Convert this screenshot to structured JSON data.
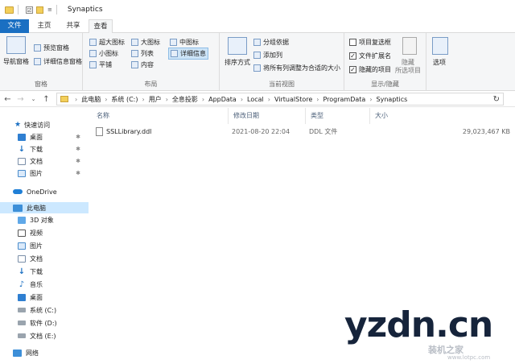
{
  "titlebar": {
    "title": "Synaptics",
    "qa_check": "☑",
    "qa_caret": "≡"
  },
  "tabs": {
    "file": "文件",
    "home": "主页",
    "share": "共享",
    "view": "查看"
  },
  "ribbon": {
    "panes": {
      "nav_pane": "导航窗格",
      "preview_pane": "预览窗格",
      "details_pane": "详细信息窗格",
      "label": "窗格"
    },
    "layout": {
      "xl_icons": "超大图标",
      "large_icons": "大图标",
      "medium_icons": "中图标",
      "small_icons": "小图标",
      "list": "列表",
      "details": "详细信息",
      "tiles": "平铺",
      "content": "内容",
      "label": "布局"
    },
    "current_view": {
      "sort_by": "排序方式",
      "group_by": "分组依据",
      "add_columns": "添加列",
      "size_all_columns": "将所有列调整为合适的大小",
      "label": "当前视图"
    },
    "show_hide": {
      "item_checkboxes": "项目复选框",
      "file_extensions": "文件扩展名",
      "hidden_items": "隐藏的项目",
      "hide_selected": "隐藏",
      "hide_selected_sub": "所选项目",
      "label": "显示/隐藏",
      "item_checkboxes_checked": false,
      "file_extensions_checked": true,
      "hidden_items_checked": true
    },
    "options": "选项"
  },
  "address": {
    "crumbs": [
      "此电脑",
      "系统 (C:)",
      "用户",
      "全息投影",
      "AppData",
      "Local",
      "VirtualStore",
      "ProgramData",
      "Synaptics"
    ]
  },
  "sidebar": {
    "quick_access": "快速访问",
    "quick_items": [
      "桌面",
      "下载",
      "文档",
      "图片"
    ],
    "onedrive": "OneDrive",
    "this_pc": "此电脑",
    "pc_items": [
      "3D 对象",
      "视频",
      "图片",
      "文档",
      "下载",
      "音乐",
      "桌面",
      "系统 (C:)",
      "软件 (D:)",
      "文档 (E:)"
    ],
    "network": "网络"
  },
  "columns": {
    "name": "名称",
    "date": "修改日期",
    "type": "类型",
    "size": "大小"
  },
  "files": [
    {
      "name": "SSLLibrary.ddl",
      "date": "2021-08-20 22:04",
      "type": "DDL 文件",
      "size": "29,023,467 KB"
    }
  ],
  "watermark": {
    "main": "yzdn.cn",
    "sub": "装机之家",
    "url": "www.lotpc.com"
  }
}
